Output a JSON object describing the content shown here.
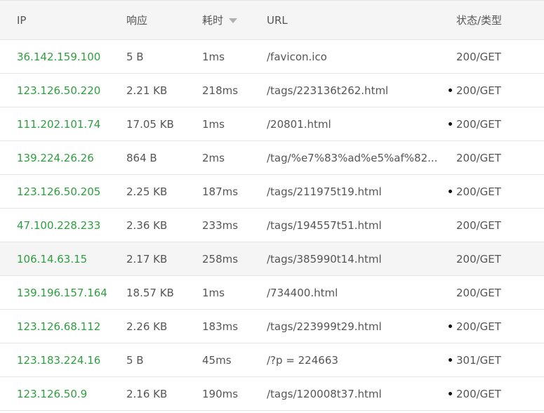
{
  "header": {
    "ip": "IP",
    "size": "响应",
    "time": "耗时",
    "url": "URL",
    "status": "状态/类型"
  },
  "rows": [
    {
      "ip": "36.142.159.100",
      "size": "5 B",
      "time": "1ms",
      "url": "/favicon.ico",
      "status": "200/GET",
      "dot": false
    },
    {
      "ip": "123.126.50.220",
      "size": "2.21 KB",
      "time": "218ms",
      "url": "/tags/223136t262.html",
      "status": "200/GET",
      "dot": true
    },
    {
      "ip": "111.202.101.74",
      "size": "17.05 KB",
      "time": "1ms",
      "url": "/20801.html",
      "status": "200/GET",
      "dot": true
    },
    {
      "ip": "139.224.26.26",
      "size": "864 B",
      "time": "2ms",
      "url": "/tag/%e7%83%ad%e5%af%82...",
      "status": "200/GET",
      "dot": false
    },
    {
      "ip": "123.126.50.205",
      "size": "2.25 KB",
      "time": "187ms",
      "url": "/tags/211975t19.html",
      "status": "200/GET",
      "dot": true
    },
    {
      "ip": "47.100.228.233",
      "size": "2.36 KB",
      "time": "233ms",
      "url": "/tags/194557t51.html",
      "status": "200/GET",
      "dot": false
    },
    {
      "ip": "106.14.63.15",
      "size": "2.17 KB",
      "time": "258ms",
      "url": "/tags/385990t14.html",
      "status": "200/GET",
      "dot": false
    },
    {
      "ip": "139.196.157.164",
      "size": "18.57 KB",
      "time": "1ms",
      "url": "/734400.html",
      "status": "200/GET",
      "dot": false
    },
    {
      "ip": "123.126.68.112",
      "size": "2.26 KB",
      "time": "183ms",
      "url": "/tags/223999t29.html",
      "status": "200/GET",
      "dot": true
    },
    {
      "ip": "123.183.224.16",
      "size": "5 B",
      "time": "45ms",
      "url": "/?p = 224663",
      "status": "301/GET",
      "dot": true
    },
    {
      "ip": "123.126.50.9",
      "size": "2.16 KB",
      "time": "190ms",
      "url": "/tags/120008t37.html",
      "status": "200/GET",
      "dot": true
    }
  ]
}
